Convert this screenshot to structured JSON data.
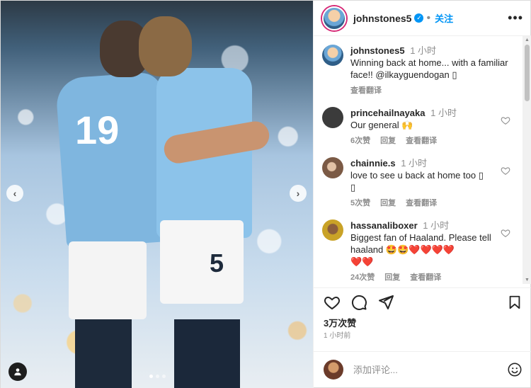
{
  "post": {
    "username": "johnstones5",
    "follow_label": "关注",
    "more_icon": "more-icon",
    "caption": {
      "username": "johnstones5",
      "time": "1 小时",
      "text": "Winning back at home... with a familiar face!! @ilkayguendogan",
      "emoji_box": "▯",
      "see_translation": "查看翻译"
    },
    "comments": [
      {
        "username": "princehailnayaka",
        "time": "1 小时",
        "text": "Our general",
        "emoji": "🙌",
        "likes": "6次赞",
        "reply": "回复",
        "translate": "查看翻译",
        "avatar_color": "#3b3b3b"
      },
      {
        "username": "chainnie.s",
        "time": "1 小时",
        "text": "love to see u back at home too",
        "emoji": "▯",
        "emoji2": "▯",
        "likes": "5次赞",
        "reply": "回复",
        "translate": "查看翻译",
        "avatar_color": "#7b5a45"
      },
      {
        "username": "hassanaliboxer",
        "time": "1 小时",
        "text": "Biggest fan of Haaland. Please tell haaland",
        "emoji": "🤩🤩❤️❤️❤️❤️",
        "emoji2": "❤️❤️",
        "likes": "24次赞",
        "reply": "回复",
        "translate": "查看翻译",
        "avatar_color": "#c9a227"
      }
    ],
    "likes_count": "3万次赞",
    "posted_ago": "1 小时前",
    "add_comment_placeholder": "添加评论...",
    "jersey_numbers": {
      "player1": "19",
      "player2": "5"
    }
  },
  "colors": {
    "accent": "#0095f6",
    "text": "#262626",
    "muted": "#8e8e8e"
  }
}
